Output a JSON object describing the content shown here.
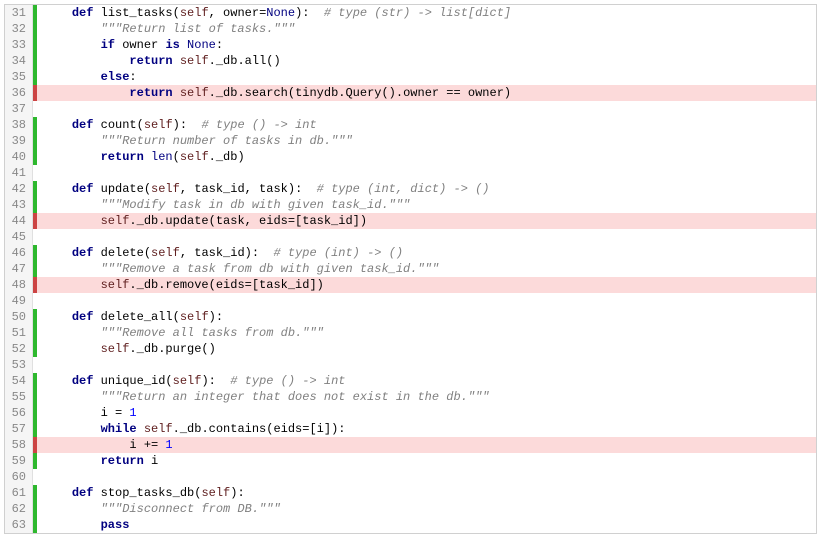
{
  "lines": [
    {
      "n": 31,
      "marker": "green",
      "hl": false,
      "tokens": [
        {
          "t": "    ",
          "c": ""
        },
        {
          "t": "def",
          "c": "def"
        },
        {
          "t": " list_tasks(",
          "c": "id"
        },
        {
          "t": "self",
          "c": "self"
        },
        {
          "t": ", owner=",
          "c": "id"
        },
        {
          "t": "None",
          "c": "builtin"
        },
        {
          "t": "):  ",
          "c": "id"
        },
        {
          "t": "# type (str) -> list[dict]",
          "c": "com"
        }
      ]
    },
    {
      "n": 32,
      "marker": "green",
      "hl": false,
      "tokens": [
        {
          "t": "        ",
          "c": ""
        },
        {
          "t": "\"\"\"Return list of tasks.\"\"\"",
          "c": "doc"
        }
      ]
    },
    {
      "n": 33,
      "marker": "green",
      "hl": false,
      "tokens": [
        {
          "t": "        ",
          "c": ""
        },
        {
          "t": "if",
          "c": "kw"
        },
        {
          "t": " owner ",
          "c": "id"
        },
        {
          "t": "is",
          "c": "kw"
        },
        {
          "t": " ",
          "c": ""
        },
        {
          "t": "None",
          "c": "builtin"
        },
        {
          "t": ":",
          "c": "id"
        }
      ]
    },
    {
      "n": 34,
      "marker": "green",
      "hl": false,
      "tokens": [
        {
          "t": "            ",
          "c": ""
        },
        {
          "t": "return",
          "c": "kw"
        },
        {
          "t": " ",
          "c": ""
        },
        {
          "t": "self",
          "c": "self"
        },
        {
          "t": "._db.all()",
          "c": "id"
        }
      ]
    },
    {
      "n": 35,
      "marker": "green",
      "hl": false,
      "tokens": [
        {
          "t": "        ",
          "c": ""
        },
        {
          "t": "else",
          "c": "kw"
        },
        {
          "t": ":",
          "c": "id"
        }
      ]
    },
    {
      "n": 36,
      "marker": "red",
      "hl": true,
      "tokens": [
        {
          "t": "            ",
          "c": ""
        },
        {
          "t": "return",
          "c": "kw"
        },
        {
          "t": " ",
          "c": ""
        },
        {
          "t": "self",
          "c": "self"
        },
        {
          "t": "._db.search(tinydb.Query().owner == owner)",
          "c": "id"
        }
      ]
    },
    {
      "n": 37,
      "marker": "",
      "hl": false,
      "tokens": []
    },
    {
      "n": 38,
      "marker": "green",
      "hl": false,
      "tokens": [
        {
          "t": "    ",
          "c": ""
        },
        {
          "t": "def",
          "c": "def"
        },
        {
          "t": " count(",
          "c": "id"
        },
        {
          "t": "self",
          "c": "self"
        },
        {
          "t": "):  ",
          "c": "id"
        },
        {
          "t": "# type () -> int",
          "c": "com"
        }
      ]
    },
    {
      "n": 39,
      "marker": "green",
      "hl": false,
      "tokens": [
        {
          "t": "        ",
          "c": ""
        },
        {
          "t": "\"\"\"Return number of tasks in db.\"\"\"",
          "c": "doc"
        }
      ]
    },
    {
      "n": 40,
      "marker": "green",
      "hl": false,
      "tokens": [
        {
          "t": "        ",
          "c": ""
        },
        {
          "t": "return",
          "c": "kw"
        },
        {
          "t": " ",
          "c": ""
        },
        {
          "t": "len",
          "c": "builtin"
        },
        {
          "t": "(",
          "c": "id"
        },
        {
          "t": "self",
          "c": "self"
        },
        {
          "t": "._db)",
          "c": "id"
        }
      ]
    },
    {
      "n": 41,
      "marker": "",
      "hl": false,
      "tokens": []
    },
    {
      "n": 42,
      "marker": "green",
      "hl": false,
      "tokens": [
        {
          "t": "    ",
          "c": ""
        },
        {
          "t": "def",
          "c": "def"
        },
        {
          "t": " update(",
          "c": "id"
        },
        {
          "t": "self",
          "c": "self"
        },
        {
          "t": ", task_id, task):  ",
          "c": "id"
        },
        {
          "t": "# type (int, dict) -> ()",
          "c": "com"
        }
      ]
    },
    {
      "n": 43,
      "marker": "green",
      "hl": false,
      "tokens": [
        {
          "t": "        ",
          "c": ""
        },
        {
          "t": "\"\"\"Modify task in db with given task_id.\"\"\"",
          "c": "doc"
        }
      ]
    },
    {
      "n": 44,
      "marker": "red",
      "hl": true,
      "tokens": [
        {
          "t": "        ",
          "c": ""
        },
        {
          "t": "self",
          "c": "self"
        },
        {
          "t": "._db.update(task, eids=[task_id])",
          "c": "id"
        }
      ]
    },
    {
      "n": 45,
      "marker": "",
      "hl": false,
      "tokens": []
    },
    {
      "n": 46,
      "marker": "green",
      "hl": false,
      "tokens": [
        {
          "t": "    ",
          "c": ""
        },
        {
          "t": "def",
          "c": "def"
        },
        {
          "t": " delete(",
          "c": "id"
        },
        {
          "t": "self",
          "c": "self"
        },
        {
          "t": ", task_id):  ",
          "c": "id"
        },
        {
          "t": "# type (int) -> ()",
          "c": "com"
        }
      ]
    },
    {
      "n": 47,
      "marker": "green",
      "hl": false,
      "tokens": [
        {
          "t": "        ",
          "c": ""
        },
        {
          "t": "\"\"\"Remove a task from db with given task_id.\"\"\"",
          "c": "doc"
        }
      ]
    },
    {
      "n": 48,
      "marker": "red",
      "hl": true,
      "tokens": [
        {
          "t": "        ",
          "c": ""
        },
        {
          "t": "self",
          "c": "self"
        },
        {
          "t": "._db.remove(eids=[task_id])",
          "c": "id"
        }
      ]
    },
    {
      "n": 49,
      "marker": "",
      "hl": false,
      "tokens": []
    },
    {
      "n": 50,
      "marker": "green",
      "hl": false,
      "tokens": [
        {
          "t": "    ",
          "c": ""
        },
        {
          "t": "def",
          "c": "def"
        },
        {
          "t": " delete_all(",
          "c": "id"
        },
        {
          "t": "self",
          "c": "self"
        },
        {
          "t": "):",
          "c": "id"
        }
      ]
    },
    {
      "n": 51,
      "marker": "green",
      "hl": false,
      "tokens": [
        {
          "t": "        ",
          "c": ""
        },
        {
          "t": "\"\"\"Remove all tasks from db.\"\"\"",
          "c": "doc"
        }
      ]
    },
    {
      "n": 52,
      "marker": "green",
      "hl": false,
      "tokens": [
        {
          "t": "        ",
          "c": ""
        },
        {
          "t": "self",
          "c": "self"
        },
        {
          "t": "._db.purge()",
          "c": "id"
        }
      ]
    },
    {
      "n": 53,
      "marker": "",
      "hl": false,
      "tokens": []
    },
    {
      "n": 54,
      "marker": "green",
      "hl": false,
      "tokens": [
        {
          "t": "    ",
          "c": ""
        },
        {
          "t": "def",
          "c": "def"
        },
        {
          "t": " unique_id(",
          "c": "id"
        },
        {
          "t": "self",
          "c": "self"
        },
        {
          "t": "):  ",
          "c": "id"
        },
        {
          "t": "# type () -> int",
          "c": "com"
        }
      ]
    },
    {
      "n": 55,
      "marker": "green",
      "hl": false,
      "tokens": [
        {
          "t": "        ",
          "c": ""
        },
        {
          "t": "\"\"\"Return an integer that does not exist in the db.\"\"\"",
          "c": "doc"
        }
      ]
    },
    {
      "n": 56,
      "marker": "green",
      "hl": false,
      "tokens": [
        {
          "t": "        i = ",
          "c": "id"
        },
        {
          "t": "1",
          "c": "num"
        }
      ]
    },
    {
      "n": 57,
      "marker": "green",
      "hl": false,
      "tokens": [
        {
          "t": "        ",
          "c": ""
        },
        {
          "t": "while",
          "c": "kw"
        },
        {
          "t": " ",
          "c": ""
        },
        {
          "t": "self",
          "c": "self"
        },
        {
          "t": "._db.contains(eids=[i]):",
          "c": "id"
        }
      ]
    },
    {
      "n": 58,
      "marker": "red",
      "hl": true,
      "tokens": [
        {
          "t": "            i += ",
          "c": "id"
        },
        {
          "t": "1",
          "c": "num"
        }
      ]
    },
    {
      "n": 59,
      "marker": "green",
      "hl": false,
      "tokens": [
        {
          "t": "        ",
          "c": ""
        },
        {
          "t": "return",
          "c": "kw"
        },
        {
          "t": " i",
          "c": "id"
        }
      ]
    },
    {
      "n": 60,
      "marker": "",
      "hl": false,
      "tokens": []
    },
    {
      "n": 61,
      "marker": "green",
      "hl": false,
      "tokens": [
        {
          "t": "    ",
          "c": ""
        },
        {
          "t": "def",
          "c": "def"
        },
        {
          "t": " stop_tasks_db(",
          "c": "id"
        },
        {
          "t": "self",
          "c": "self"
        },
        {
          "t": "):",
          "c": "id"
        }
      ]
    },
    {
      "n": 62,
      "marker": "green",
      "hl": false,
      "tokens": [
        {
          "t": "        ",
          "c": ""
        },
        {
          "t": "\"\"\"Disconnect from DB.\"\"\"",
          "c": "doc"
        }
      ]
    },
    {
      "n": 63,
      "marker": "green",
      "hl": false,
      "tokens": [
        {
          "t": "        ",
          "c": ""
        },
        {
          "t": "pass",
          "c": "kw"
        }
      ]
    }
  ]
}
